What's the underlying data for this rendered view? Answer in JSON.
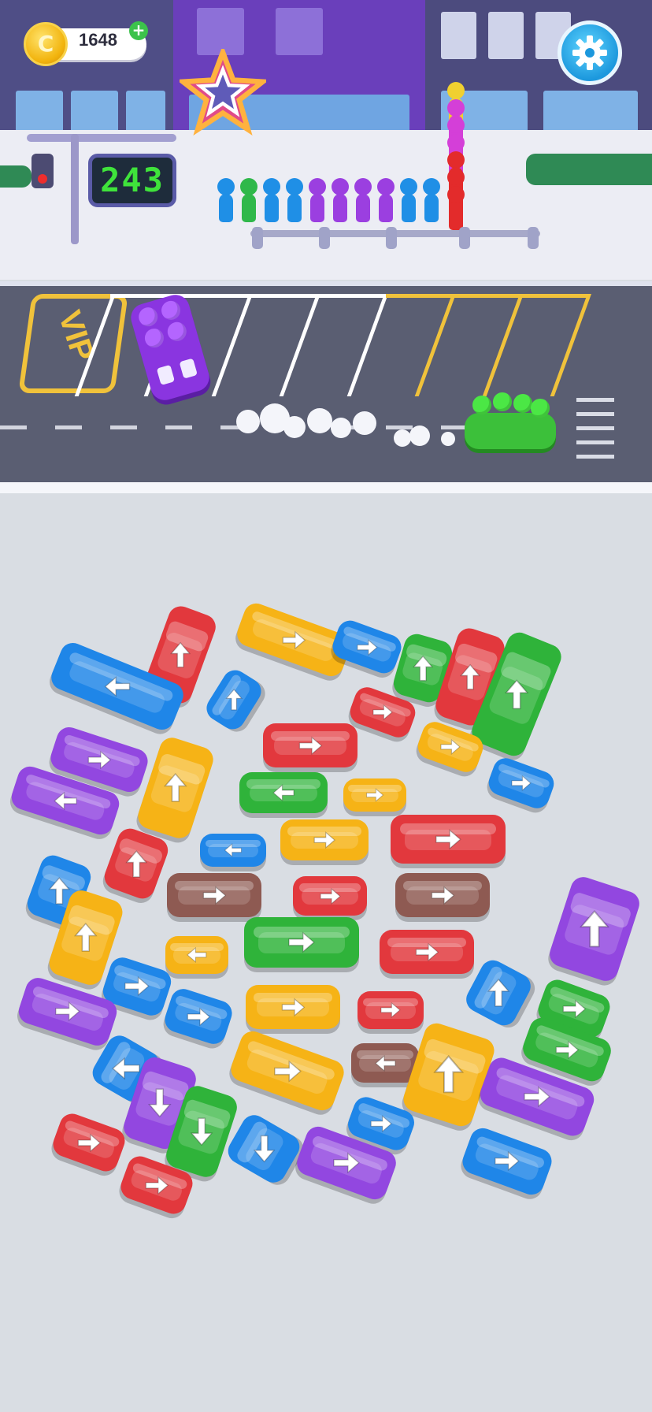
{
  "hud": {
    "coins": "1648",
    "add_coins_label": "+",
    "coin_symbol": "C",
    "settings_icon": "gear-icon"
  },
  "street": {
    "countdown": "243",
    "vip_label": "VIP",
    "queue_colors": [
      "#1f8fe6",
      "#2fb84a",
      "#1f8fe6",
      "#1f8fe6",
      "#9b3fe0",
      "#9b3fe0",
      "#9b3fe0",
      "#9b3fe0",
      "#1f8fe6",
      "#1f8fe6"
    ],
    "stacked_colors": [
      "#f0d030",
      "#d43fd8",
      "#d43fd8",
      "#d43fd8",
      "#e32b2b",
      "#e32b2b",
      "#e32b2b"
    ]
  },
  "parking": {
    "parked_car": {
      "color": "#8a35e0",
      "passengers": 4
    },
    "leaving_car": {
      "color": "#3cc03a",
      "passengers": 4
    }
  },
  "colors": {
    "red": "#e2383d",
    "blue": "#1f86e8",
    "yellow": "#f6b316",
    "green": "#2fb33a",
    "purple": "#9247e0",
    "brown": "#8e5a52"
  },
  "vehicles": [
    {
      "type": "van",
      "color": "red",
      "dir": "up"
    },
    {
      "type": "bus",
      "color": "yellow",
      "dir": "right"
    },
    {
      "type": "car",
      "color": "blue",
      "dir": "right"
    },
    {
      "type": "car",
      "color": "green",
      "dir": "up"
    },
    {
      "type": "van",
      "color": "red",
      "dir": "up"
    },
    {
      "type": "bus",
      "color": "green",
      "dir": "up"
    },
    {
      "type": "bus",
      "color": "blue",
      "dir": "left"
    },
    {
      "type": "car",
      "color": "blue",
      "dir": "up"
    },
    {
      "type": "car",
      "color": "red",
      "dir": "right"
    },
    {
      "type": "car",
      "color": "yellow",
      "dir": "right"
    },
    {
      "type": "bus",
      "color": "red",
      "dir": "right"
    },
    {
      "type": "van",
      "color": "purple",
      "dir": "right"
    },
    {
      "type": "van",
      "color": "yellow",
      "dir": "up"
    },
    {
      "type": "bus",
      "color": "green",
      "dir": "left"
    },
    {
      "type": "car",
      "color": "yellow",
      "dir": "right"
    },
    {
      "type": "car",
      "color": "blue",
      "dir": "right"
    },
    {
      "type": "bus",
      "color": "purple",
      "dir": "left"
    },
    {
      "type": "car",
      "color": "red",
      "dir": "up"
    },
    {
      "type": "car",
      "color": "blue",
      "dir": "left"
    },
    {
      "type": "bus",
      "color": "yellow",
      "dir": "right"
    },
    {
      "type": "bus",
      "color": "red",
      "dir": "right"
    },
    {
      "type": "car",
      "color": "blue",
      "dir": "up"
    },
    {
      "type": "van",
      "color": "yellow",
      "dir": "up"
    },
    {
      "type": "bus",
      "color": "brown",
      "dir": "right"
    },
    {
      "type": "car",
      "color": "red",
      "dir": "right"
    },
    {
      "type": "bus",
      "color": "brown",
      "dir": "right"
    },
    {
      "type": "van",
      "color": "purple",
      "dir": "up"
    },
    {
      "type": "car",
      "color": "yellow",
      "dir": "left"
    },
    {
      "type": "bus",
      "color": "green",
      "dir": "right"
    },
    {
      "type": "bus",
      "color": "red",
      "dir": "right"
    },
    {
      "type": "car",
      "color": "blue",
      "dir": "right"
    },
    {
      "type": "car",
      "color": "blue",
      "dir": "up"
    },
    {
      "type": "car",
      "color": "blue",
      "dir": "right"
    },
    {
      "type": "van",
      "color": "purple",
      "dir": "right"
    },
    {
      "type": "car",
      "color": "yellow",
      "dir": "right"
    },
    {
      "type": "bus",
      "color": "red",
      "dir": "right"
    },
    {
      "type": "car",
      "color": "green",
      "dir": "right"
    },
    {
      "type": "car",
      "color": "green",
      "dir": "right"
    },
    {
      "type": "car",
      "color": "blue",
      "dir": "left"
    },
    {
      "type": "bus",
      "color": "yellow",
      "dir": "right"
    },
    {
      "type": "car",
      "color": "brown",
      "dir": "left"
    },
    {
      "type": "van",
      "color": "yellow",
      "dir": "up"
    },
    {
      "type": "van",
      "color": "purple",
      "dir": "down"
    },
    {
      "type": "van",
      "color": "green",
      "dir": "down"
    },
    {
      "type": "bus",
      "color": "purple",
      "dir": "right"
    },
    {
      "type": "car",
      "color": "red",
      "dir": "right"
    },
    {
      "type": "car",
      "color": "blue",
      "dir": "right"
    },
    {
      "type": "car",
      "color": "blue",
      "dir": "down"
    },
    {
      "type": "van",
      "color": "purple",
      "dir": "right"
    },
    {
      "type": "car",
      "color": "red",
      "dir": "right"
    },
    {
      "type": "van",
      "color": "blue",
      "dir": "right"
    }
  ]
}
